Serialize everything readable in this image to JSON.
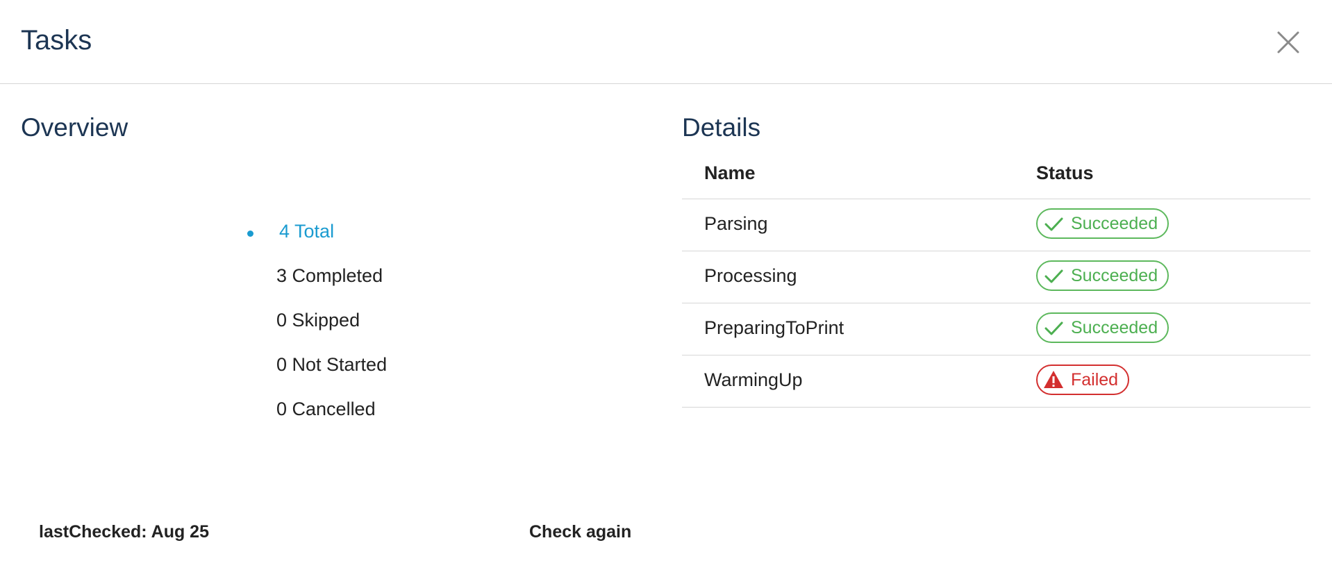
{
  "dialog": {
    "title": "Tasks"
  },
  "overview": {
    "title": "Overview",
    "legend": [
      {
        "label": "4 Total",
        "active": true
      },
      {
        "label": "3 Completed"
      },
      {
        "label": "0 Skipped"
      },
      {
        "label": "0 Not Started"
      },
      {
        "label": "0 Cancelled"
      }
    ]
  },
  "details": {
    "title": "Details",
    "columns": {
      "name": "Name",
      "status": "Status"
    },
    "rows": [
      {
        "name": "Parsing",
        "status": "Succeeded",
        "icon": "check-icon"
      },
      {
        "name": "Processing",
        "status": "Succeeded",
        "icon": "check-icon"
      },
      {
        "name": "PreparingToPrint",
        "status": "Succeeded",
        "icon": "check-icon"
      },
      {
        "name": "WarmingUp",
        "status": "Failed",
        "icon": "warning-icon"
      }
    ]
  },
  "footer": {
    "last_checked": "lastChecked: Aug 25",
    "check_again": "Check again"
  },
  "colors": {
    "accent": "#1a9bd0",
    "success": "#4caf50",
    "failure": "#d32f2f",
    "heading": "#1c3553"
  }
}
